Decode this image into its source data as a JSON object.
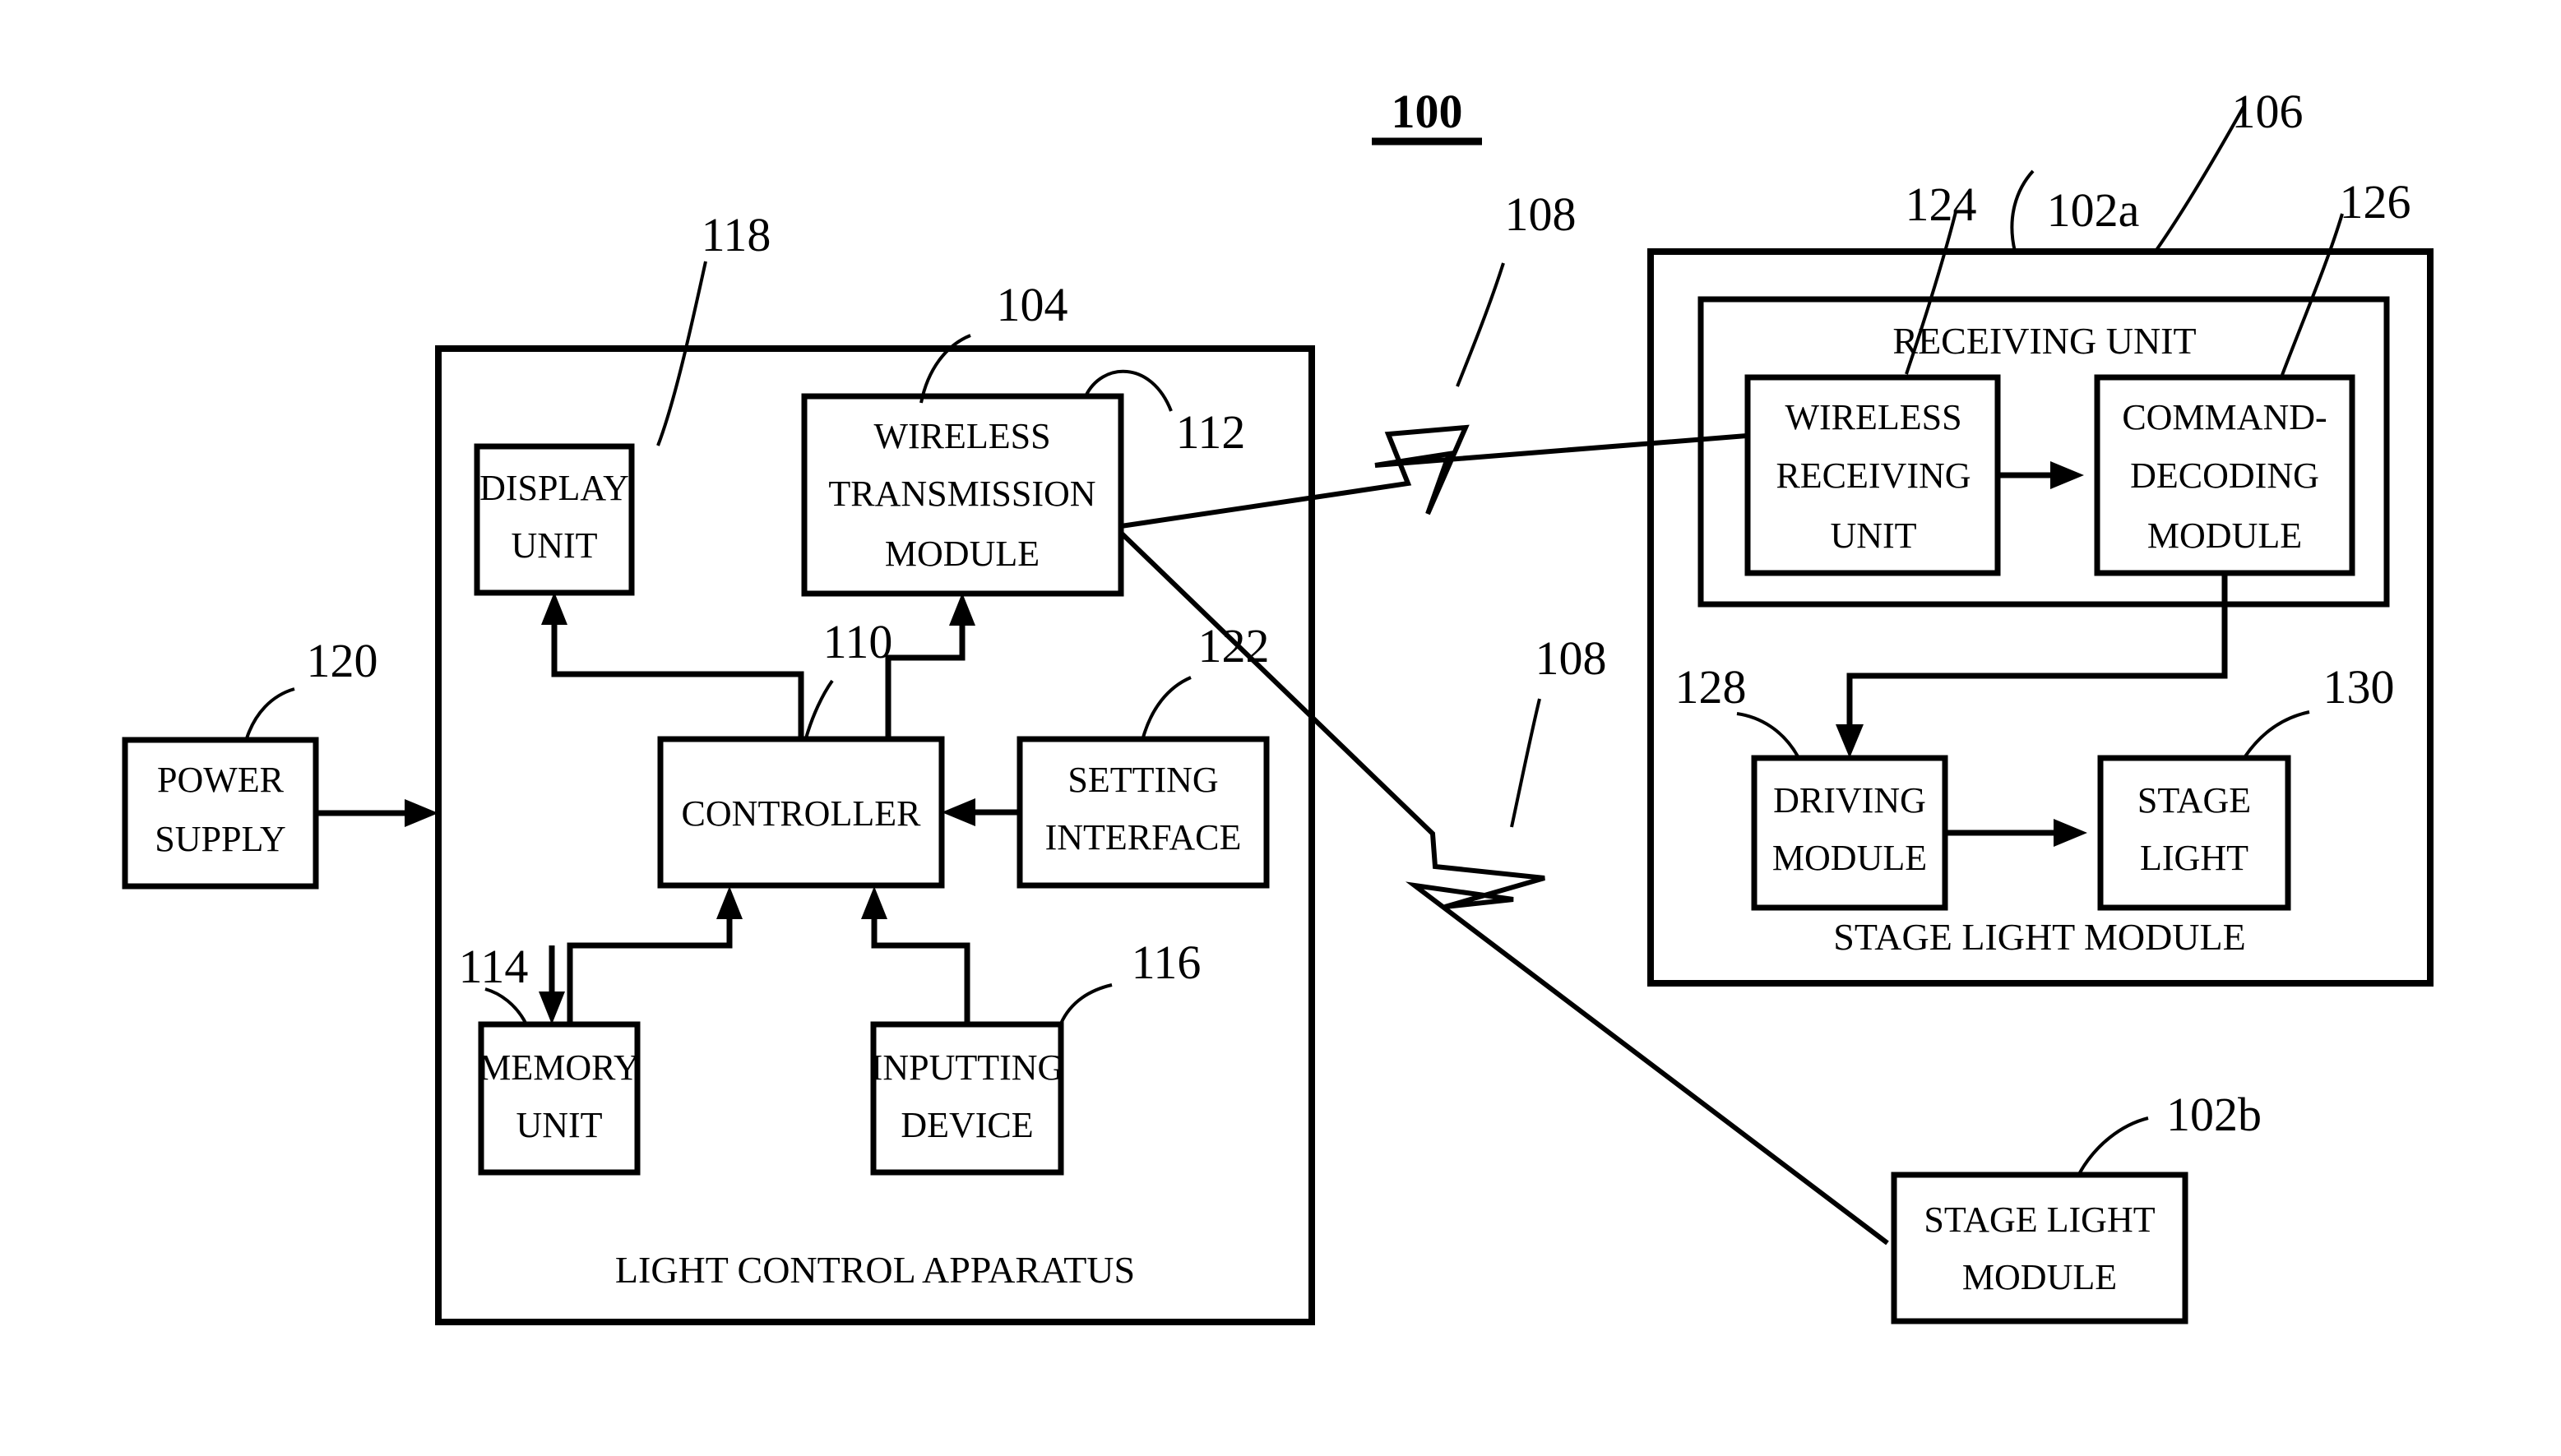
{
  "figure": {
    "title_ref": "100",
    "type": "patent-block-diagram"
  },
  "reference_numerals": {
    "system": "100",
    "light_control_apparatus": "104",
    "receiving_unit_assembly": "106",
    "wireless_signal_upper": "108",
    "wireless_signal_lower": "108",
    "controller": "110",
    "wireless_transmission_module": "112",
    "memory_unit": "114",
    "inputting_device": "116",
    "display_unit": "118",
    "power_supply": "120",
    "setting_interface": "122",
    "wireless_receiving_unit": "124",
    "command_decoding_module": "126",
    "driving_module": "128",
    "stage_light": "130",
    "stage_light_module_a": "102a",
    "stage_light_module_b": "102b"
  },
  "blocks": {
    "light_control_apparatus": {
      "label": "LIGHT CONTROL APPARATUS",
      "ref": "104"
    },
    "display_unit": {
      "line1": "DISPLAY",
      "line2": "UNIT",
      "ref": "118"
    },
    "wireless_transmission_module": {
      "line1": "WIRELESS",
      "line2": "TRANSMISSION",
      "line3": "MODULE",
      "ref": "112"
    },
    "controller": {
      "label": "CONTROLLER",
      "ref": "110"
    },
    "setting_interface": {
      "line1": "SETTING",
      "line2": "INTERFACE",
      "ref": "122"
    },
    "memory_unit": {
      "line1": "MEMORY",
      "line2": "UNIT",
      "ref": "114"
    },
    "inputting_device": {
      "line1": "INPUTTING",
      "line2": "DEVICE",
      "ref": "116"
    },
    "power_supply": {
      "line1": "POWER",
      "line2": "SUPPLY",
      "ref": "120"
    },
    "stage_light_module_a": {
      "label": "STAGE LIGHT MODULE",
      "ref": "102a",
      "outer_ref": "106"
    },
    "receiving_unit": {
      "label": "RECEIVING UNIT",
      "ref": "106"
    },
    "wireless_receiving_unit": {
      "line1": "WIRELESS",
      "line2": "RECEIVING",
      "line3": "UNIT",
      "ref": "124"
    },
    "command_decoding_module": {
      "line1": "COMMAND-",
      "line2": "DECODING",
      "line3": "MODULE",
      "ref": "126"
    },
    "driving_module": {
      "line1": "DRIVING",
      "line2": "MODULE",
      "ref": "128"
    },
    "stage_light": {
      "line1": "STAGE",
      "line2": "LIGHT",
      "ref": "130"
    },
    "stage_light_module_b": {
      "line1": "STAGE LIGHT",
      "line2": "MODULE",
      "ref": "102b"
    }
  },
  "colors": {
    "stroke": "#000000",
    "background": "#ffffff"
  }
}
